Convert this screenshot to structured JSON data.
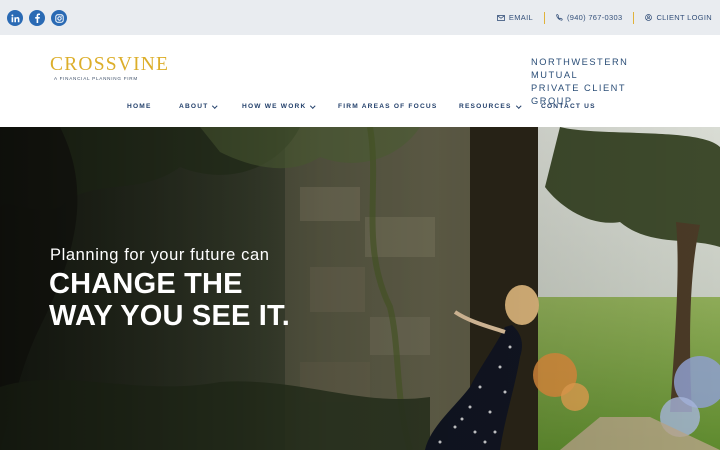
{
  "topbar": {
    "social": [
      {
        "icon": "linkedin-icon",
        "label": "in"
      },
      {
        "icon": "facebook-icon",
        "label": "f"
      },
      {
        "icon": "instagram-icon",
        "label": ""
      }
    ],
    "email_label": "EMAIL",
    "phone_label": "(940) 767-0303",
    "client_login_label": "CLIENT LOGIN"
  },
  "header": {
    "logo_text": "CROSSVINE",
    "logo_tagline": "A FINANCIAL PLANNING FIRM",
    "affiliation_line1": "NORTHWESTERN MUTUAL",
    "affiliation_line2": "PRIVATE CLIENT GROUP"
  },
  "nav": {
    "items": [
      {
        "label": "HOME",
        "has_dropdown": false
      },
      {
        "label": "ABOUT",
        "has_dropdown": true
      },
      {
        "label": "HOW WE WORK",
        "has_dropdown": true
      },
      {
        "label": "FIRM AREAS OF FOCUS",
        "has_dropdown": false
      },
      {
        "label": "RESOURCES",
        "has_dropdown": true
      },
      {
        "label": "CONTACT US",
        "has_dropdown": false
      }
    ]
  },
  "hero": {
    "subtitle": "Planning for your future can",
    "title_line1": "CHANGE THE",
    "title_line2": "WAY YOU SEE IT."
  },
  "colors": {
    "brand_gold": "#dcae2a",
    "brand_navy": "#23406b",
    "social_blue": "#2a6ab4",
    "topbar_bg": "#e9ecf0"
  }
}
